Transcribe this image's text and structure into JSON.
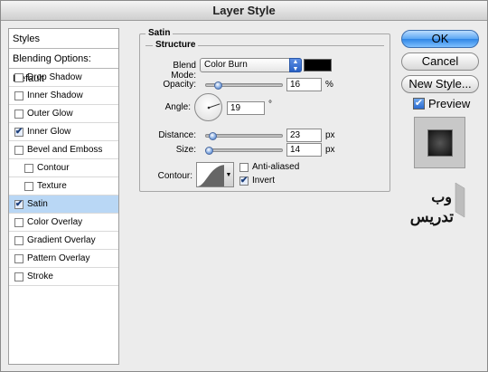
{
  "window": {
    "title": "Layer Style"
  },
  "styles_panel": {
    "header": "Styles",
    "blending_options": "Blending Options: Default",
    "items": [
      {
        "label": "Drop Shadow",
        "checked": false,
        "indent": false,
        "selected": false
      },
      {
        "label": "Inner Shadow",
        "checked": false,
        "indent": false,
        "selected": false
      },
      {
        "label": "Outer Glow",
        "checked": false,
        "indent": false,
        "selected": false
      },
      {
        "label": "Inner Glow",
        "checked": true,
        "indent": false,
        "selected": false
      },
      {
        "label": "Bevel and Emboss",
        "checked": false,
        "indent": false,
        "selected": false
      },
      {
        "label": "Contour",
        "checked": false,
        "indent": true,
        "selected": false
      },
      {
        "label": "Texture",
        "checked": false,
        "indent": true,
        "selected": false
      },
      {
        "label": "Satin",
        "checked": true,
        "indent": false,
        "selected": true
      },
      {
        "label": "Color Overlay",
        "checked": false,
        "indent": false,
        "selected": false
      },
      {
        "label": "Gradient Overlay",
        "checked": false,
        "indent": false,
        "selected": false
      },
      {
        "label": "Pattern Overlay",
        "checked": false,
        "indent": false,
        "selected": false
      },
      {
        "label": "Stroke",
        "checked": false,
        "indent": false,
        "selected": false
      }
    ]
  },
  "satin": {
    "group_title": "Satin",
    "structure_title": "Structure",
    "blend_mode_label": "Blend Mode:",
    "blend_mode_value": "Color Burn",
    "color": "#000000",
    "opacity_label": "Opacity:",
    "opacity_value": "16",
    "opacity_unit": "%",
    "opacity_fraction": 0.16,
    "angle_label": "Angle:",
    "angle_value": "19",
    "angle_unit": "°",
    "distance_label": "Distance:",
    "distance_value": "23",
    "distance_unit": "px",
    "distance_fraction": 0.09,
    "size_label": "Size:",
    "size_value": "14",
    "size_unit": "px",
    "size_fraction": 0.05,
    "contour_label": "Contour:",
    "anti_aliased_label": "Anti-aliased",
    "anti_aliased_checked": false,
    "invert_label": "Invert",
    "invert_checked": true
  },
  "buttons": {
    "ok": "OK",
    "cancel": "Cancel",
    "new_style": "New Style...",
    "preview_label": "Preview",
    "preview_checked": true
  },
  "colors": {
    "accent": "#3a7fe0",
    "selection": "#b9d7f5",
    "preview_swatch": "#2b2b2b"
  },
  "logo": {
    "text": "وب تدریس"
  }
}
